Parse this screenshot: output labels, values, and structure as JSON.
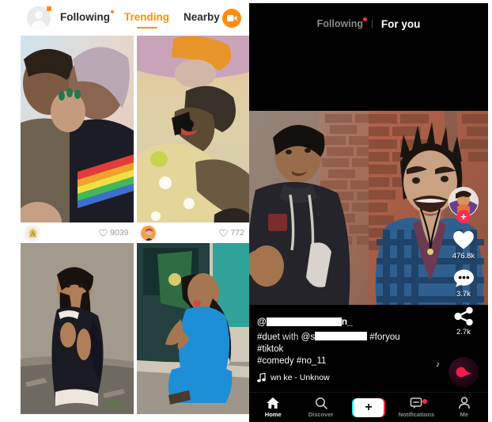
{
  "left_panel": {
    "header": {
      "avatar_name": "user-avatar",
      "has_notification_dot": true,
      "tabs": [
        {
          "label": "Following",
          "active": false,
          "dot": true
        },
        {
          "label": "Trending",
          "active": true,
          "dot": false
        },
        {
          "label": "Nearby",
          "active": false,
          "dot": false
        }
      ],
      "camera_button": "camera-icon",
      "accent_color": "#ff9000"
    },
    "grid": [
      {
        "id": "tile-1",
        "likes": "9039",
        "has_avatar": true,
        "description": "couple kissing, rainbow stripe tee"
      },
      {
        "id": "tile-2",
        "likes": "772",
        "has_avatar": true,
        "description": "person with german shepherd dog"
      },
      {
        "id": "tile-3",
        "likes": "",
        "has_avatar": false,
        "description": "girl standing by stone wall in dark outfit"
      },
      {
        "id": "tile-4",
        "likes": "",
        "has_avatar": false,
        "description": "girl in blue dress sitting on step"
      }
    ]
  },
  "right_panel": {
    "header": {
      "tabs": [
        {
          "label": "Following",
          "active": false,
          "dot": true
        },
        {
          "label": "For you",
          "active": true,
          "dot": false
        }
      ],
      "separator": "|"
    },
    "video": {
      "type": "duet-split-screen",
      "left_description": "young man in dark hoodie gesturing, brick wall",
      "right_description": "young man in blue plaid shirt, spiky hair, brick wall"
    },
    "rail": {
      "avatar_name": "creator-avatar",
      "follow_label": "+",
      "actions": [
        {
          "icon": "heart-icon",
          "count": "476.8k"
        },
        {
          "icon": "comment-icon",
          "count": "3.7k"
        },
        {
          "icon": "share-icon",
          "count": "2.7k"
        }
      ]
    },
    "caption": {
      "username_prefix": "@",
      "username_redacted": true,
      "username_suffix": "n_",
      "line1_a": "#duet",
      "line1_b": "with",
      "line1_c": "@s",
      "line1_d": "#foryou #tiktok",
      "line2": "#comedy #no_11",
      "music_icon": "music-note-icon",
      "music_title": "wn  ke - Unknow"
    },
    "music_disc": "music-disc",
    "bottom_nav": [
      {
        "label": "Home",
        "icon": "home-icon",
        "active": true
      },
      {
        "label": "Discover",
        "icon": "search-icon",
        "active": false
      },
      {
        "label": "",
        "icon": "plus-button",
        "active": false
      },
      {
        "label": "Notifications",
        "icon": "inbox-icon",
        "active": false,
        "dot": true
      },
      {
        "label": "Me",
        "icon": "person-icon",
        "active": false
      }
    ],
    "accent_color": "#fe2c55",
    "accent_color_2": "#28f4ef"
  }
}
